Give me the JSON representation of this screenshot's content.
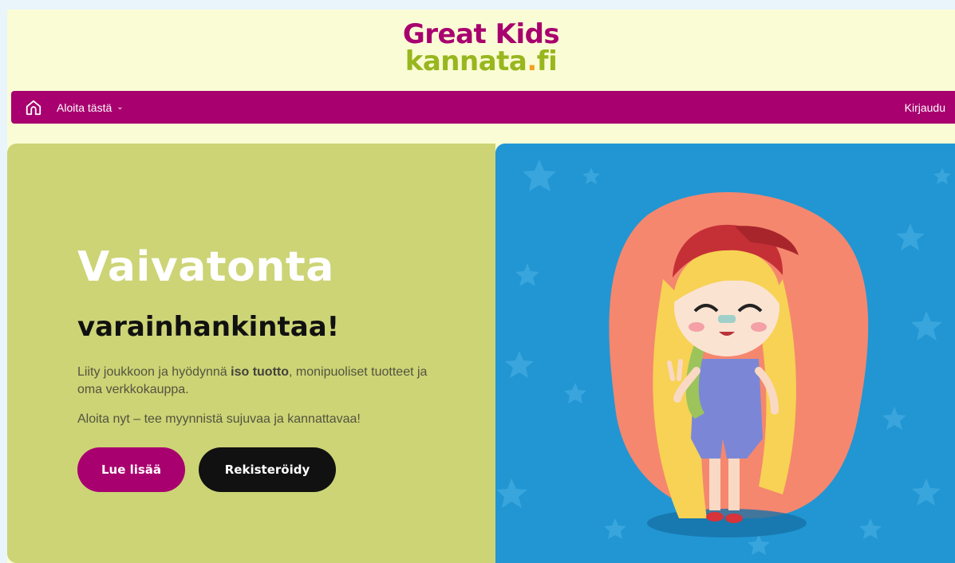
{
  "logo": {
    "line1": "Great Kids",
    "line2_main": "kannata",
    "line2_dot": ".",
    "line2_end": "fi"
  },
  "nav": {
    "home_icon": "home-icon",
    "menu_label": "Aloita tästä",
    "menu_chevron": "⌄",
    "login_label": "Kirjaudu"
  },
  "hero": {
    "title": "Vaivatonta",
    "subtitle": "varainhankintaa!",
    "text1_before": "Liity joukkoon ja hyödynnä ",
    "text1_bold": "iso tuotto",
    "text1_after": ", monipuoliset tuotteet ja oma verkkokauppa.",
    "text2": "Aloita nyt – tee myynnistä sujuvaa ja kannattavaa!",
    "btn_read": "Lue lisää",
    "btn_register": "Rekisteröidy",
    "illustration": "girl-illustration"
  },
  "colors": {
    "brand": "#a8006e",
    "green": "#ccd476",
    "blue": "#2196d3",
    "cream": "#fafcd5"
  }
}
